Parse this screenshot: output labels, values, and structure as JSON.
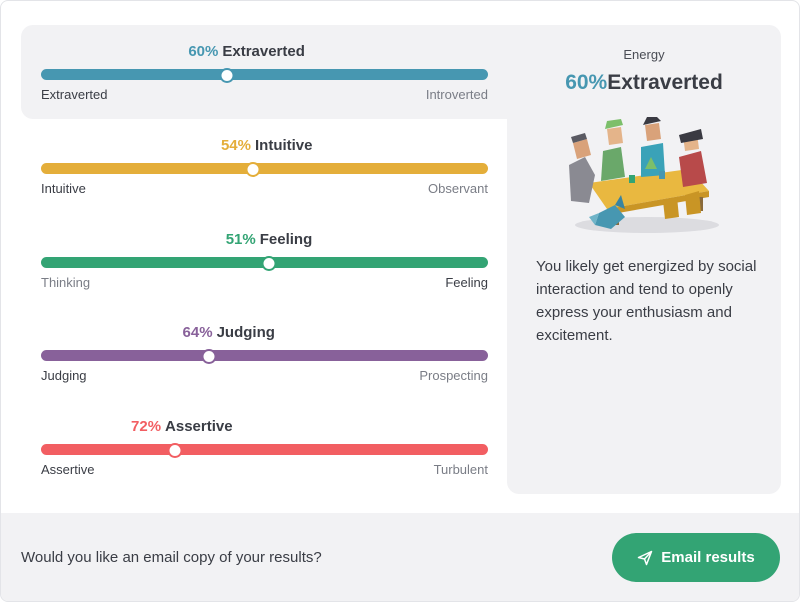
{
  "traits": [
    {
      "key": "energy",
      "percent_label": "60%",
      "name": "Extraverted",
      "left_pole": "Extraverted",
      "right_pole": "Introverted",
      "value": 0.4,
      "color": "#4797b1",
      "active": true
    },
    {
      "key": "mind",
      "percent_label": "54%",
      "name": "Intuitive",
      "left_pole": "Intuitive",
      "right_pole": "Observant",
      "value": 0.475,
      "color": "#e4ae3a",
      "active": false
    },
    {
      "key": "nature",
      "percent_label": "51%",
      "name": "Feeling",
      "left_pole": "Thinking",
      "right_pole": "Feeling",
      "value": 0.51,
      "color": "#33a474",
      "active": false
    },
    {
      "key": "tactics",
      "percent_label": "64%",
      "name": "Judging",
      "left_pole": "Judging",
      "right_pole": "Prospecting",
      "value": 0.375,
      "color": "#88619a",
      "active": false
    },
    {
      "key": "identity",
      "percent_label": "72%",
      "name": "Assertive",
      "left_pole": "Assertive",
      "right_pole": "Turbulent",
      "value": 0.3,
      "color": "#f25e62",
      "active": false
    }
  ],
  "panel": {
    "kicker": "Energy",
    "percent_label": "60%",
    "trait_name": "Extraverted",
    "description": "You likely get energized by social interaction and tend to openly express your enthusiasm and excitement.",
    "illustration_icon": "group-of-people-at-table-illustration"
  },
  "footer": {
    "question": "Would you like an email copy of your results?",
    "button_label": "Email results",
    "button_icon": "send-icon",
    "button_color": "#33a474"
  }
}
